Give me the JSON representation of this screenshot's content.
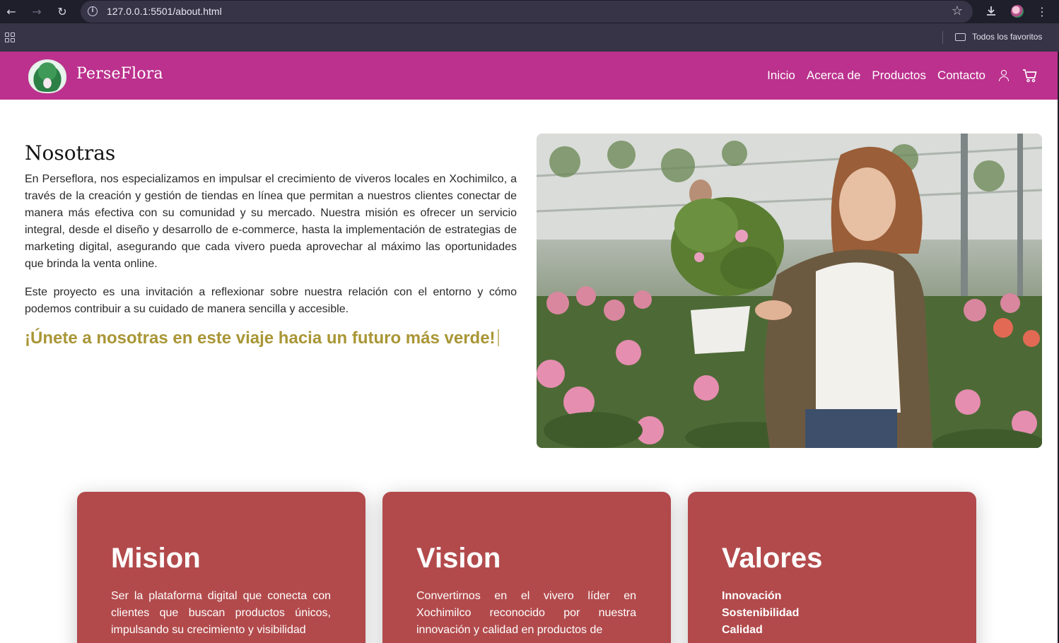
{
  "browser": {
    "url": "127.0.0.1:5501/about.html",
    "bookmarks_folder": "Todos los favoritos",
    "icons": {
      "back": "arrow-left-icon",
      "forward": "arrow-right-icon",
      "reload": "reload-icon",
      "site_info": "info-icon",
      "bookmark": "star-icon",
      "download": "download-icon",
      "menu": "kebab-menu-icon",
      "apps": "apps-grid-icon",
      "folder": "folder-icon"
    }
  },
  "header": {
    "brand": "PerseFlora",
    "nav": [
      "Inicio",
      "Acerca de",
      "Productos",
      "Contacto"
    ],
    "icons": [
      "user-icon",
      "cart-icon"
    ],
    "background_color": "#bb318d"
  },
  "about": {
    "title": "Nosotras",
    "paragraph1": "En Perseflora, nos especializamos en impulsar el crecimiento de viveros locales en Xochimilco, a través de la creación y gestión de tiendas en línea que permitan a nuestros clientes conectar de manera más efectiva con su comunidad y su mercado. Nuestra misión es ofrecer un servicio integral, desde el diseño y desarrollo de e-commerce, hasta la implementación de estrategias de marketing digital, asegurando que cada vivero pueda aprovechar al máximo las oportunidades que brinda la venta online.",
    "paragraph2": "Este proyecto es una invitación a reflexionar sobre nuestra relación con el entorno y cómo podemos contribuir a su cuidado de manera sencilla y accesible.",
    "tagline": "¡Únete a nosotras en este viaje hacia un futuro más verde!",
    "tagline_color": "#a99636"
  },
  "cards": {
    "color": "#b24a4c",
    "mision": {
      "title": "Mision",
      "text": "Ser la plataforma digital que conecta con clientes que buscan productos únicos, impulsando su crecimiento y visibilidad"
    },
    "vision": {
      "title": "Vision",
      "text": "Convertirnos en el vivero líder en Xochimilco reconocido por nuestra innovación y calidad en productos de"
    },
    "valores": {
      "title": "Valores",
      "items": [
        "Innovación",
        "Sostenibilidad",
        "Calidad"
      ]
    }
  }
}
